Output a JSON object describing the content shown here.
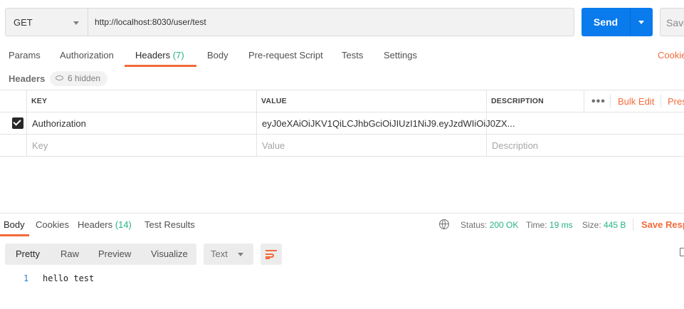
{
  "request": {
    "method": "GET",
    "url": "http://localhost:8030/user/test",
    "send_label": "Send",
    "save_label": "Save"
  },
  "request_tabs": [
    {
      "label": "Params",
      "count": ""
    },
    {
      "label": "Authorization",
      "count": ""
    },
    {
      "label": "Headers",
      "count": "(7)"
    },
    {
      "label": "Body",
      "count": ""
    },
    {
      "label": "Pre-request Script",
      "count": ""
    },
    {
      "label": "Tests",
      "count": ""
    },
    {
      "label": "Settings",
      "count": ""
    }
  ],
  "active_request_tab": "Headers",
  "cookies_link": "Cookies",
  "headers_section": {
    "title": "Headers",
    "hidden_badge": "6 hidden"
  },
  "headers_table": {
    "columns": [
      "KEY",
      "VALUE",
      "DESCRIPTION"
    ],
    "bulk_edit": "Bulk Edit",
    "presets": "Presets",
    "rows": [
      {
        "checked": true,
        "key": "Authorization",
        "value": "eyJ0eXAiOiJKV1QiLCJhbGciOiJIUzI1NiJ9.eyJzdWIiOiJ0ZX...",
        "description": ""
      }
    ],
    "placeholder": {
      "key": "Key",
      "value": "Value",
      "description": "Description"
    }
  },
  "response_tabs": [
    {
      "label": "Body",
      "count": ""
    },
    {
      "label": "Cookies",
      "count": ""
    },
    {
      "label": "Headers",
      "count": "(14)"
    },
    {
      "label": "Test Results",
      "count": ""
    }
  ],
  "active_response_tab": "Body",
  "response_status": {
    "status_label": "Status:",
    "status_value": "200 OK",
    "time_label": "Time:",
    "time_value": "19 ms",
    "size_label": "Size:",
    "size_value": "445 B",
    "save_response": "Save Response"
  },
  "body_view": {
    "modes": [
      "Pretty",
      "Raw",
      "Preview",
      "Visualize"
    ],
    "active_mode": "Pretty",
    "format": "Text"
  },
  "response_body": {
    "lines": [
      {
        "number": "1",
        "text": "hello test"
      }
    ]
  },
  "icons": {
    "method_dropdown": "chevron-down-icon",
    "send_dropdown": "chevron-down-icon",
    "hidden_badge": "eye-icon",
    "more_options": "ellipsis-icon",
    "network": "globe-icon",
    "wrap": "wrap-lines-icon",
    "copy": "copy-icon"
  },
  "colors": {
    "accent": "#f26b3a",
    "primary_button": "#097bed",
    "success": "#26b47f",
    "line_number": "#2d7ed1"
  }
}
